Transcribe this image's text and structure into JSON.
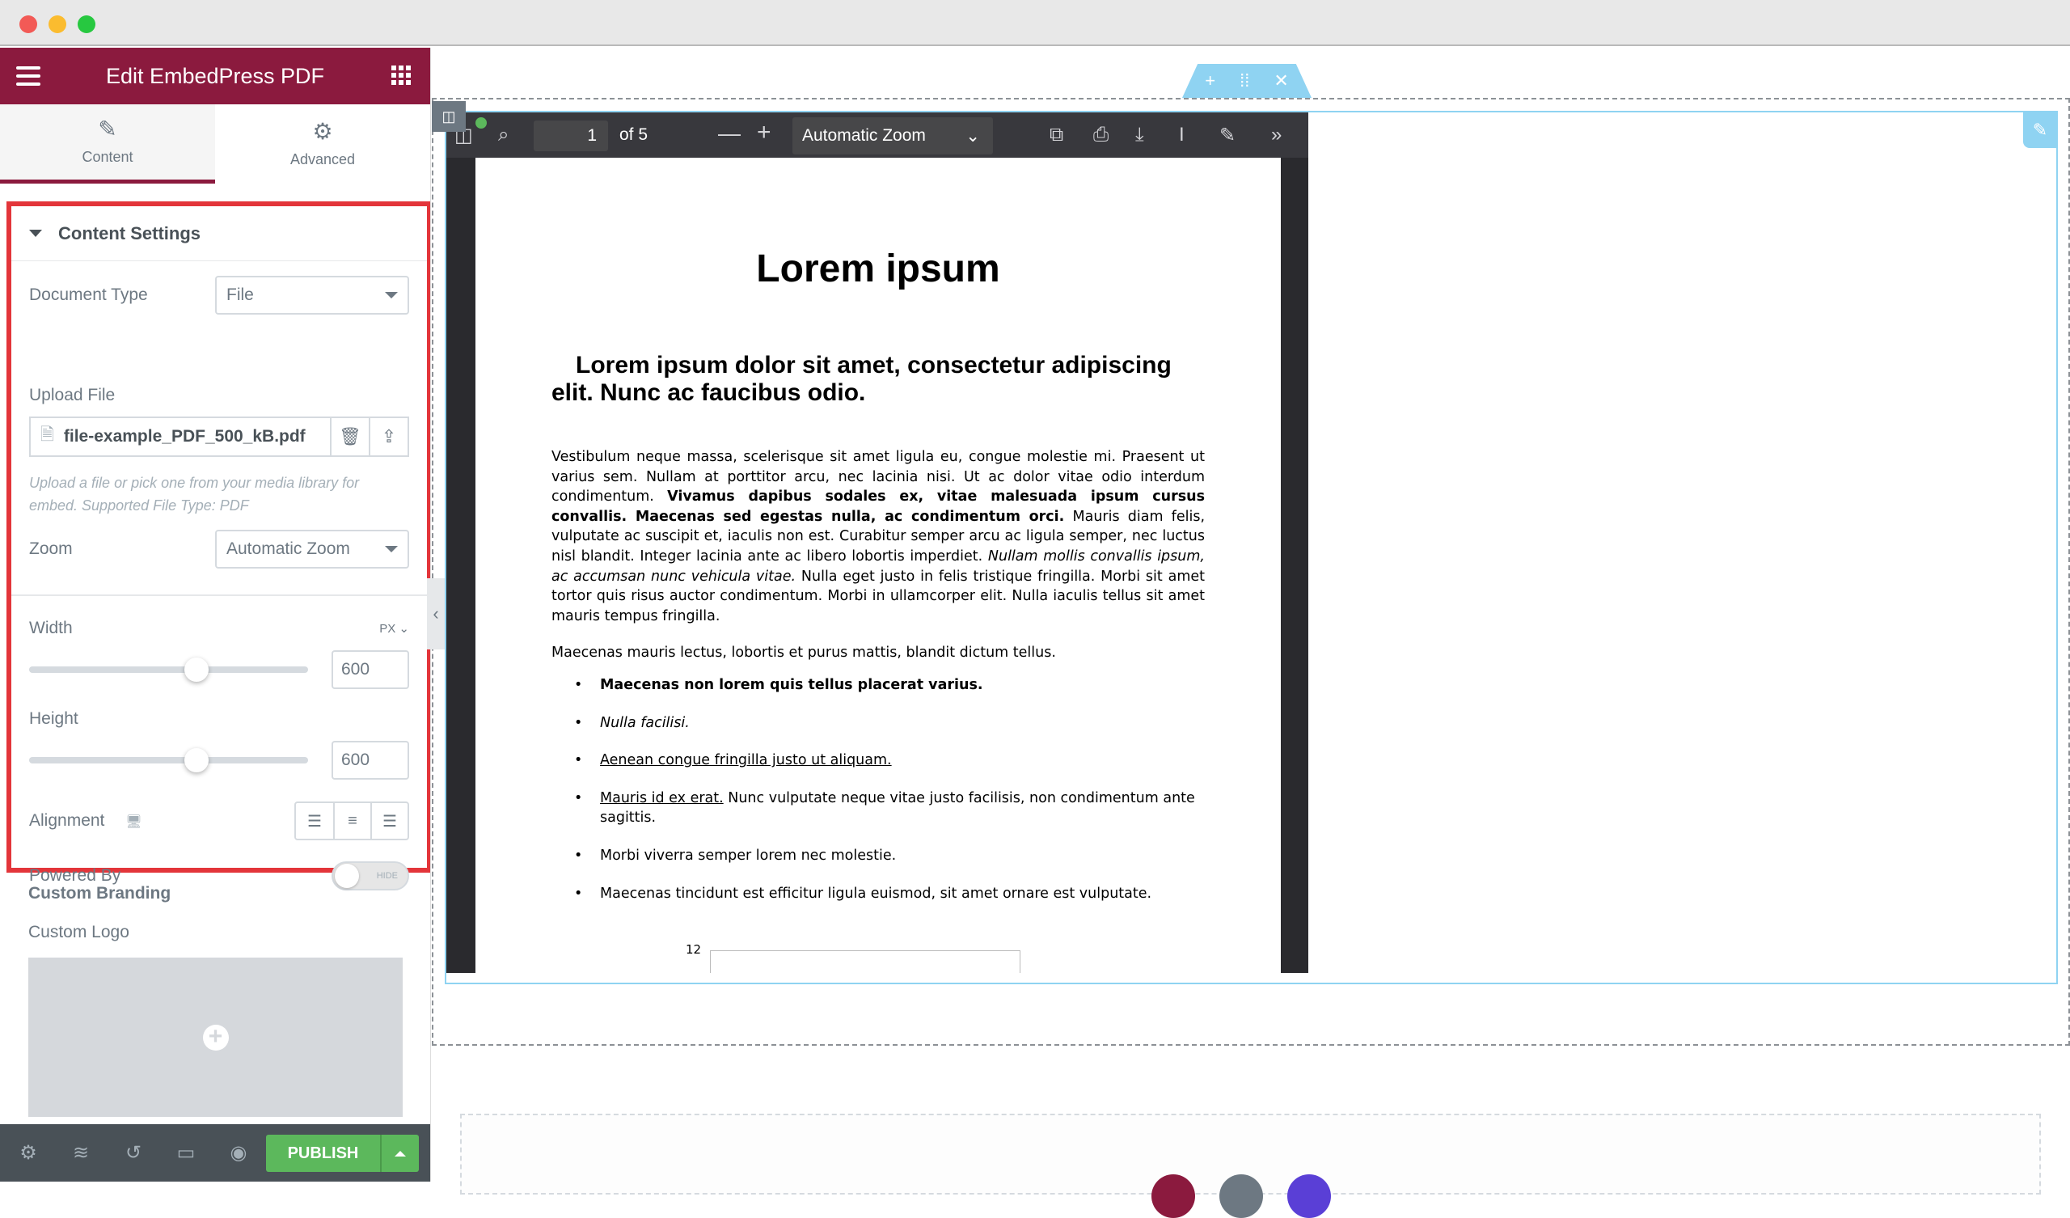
{
  "window": {
    "controls": [
      "close",
      "minimize",
      "maximize"
    ]
  },
  "sidebar": {
    "title": "Edit EmbedPress PDF",
    "tabs": [
      {
        "label": "Content",
        "icon": "pencil-icon",
        "active": true
      },
      {
        "label": "Advanced",
        "icon": "gear-icon",
        "active": false
      }
    ],
    "section_title": "Content Settings",
    "document_type": {
      "label": "Document Type",
      "value": "File"
    },
    "upload_file": {
      "label": "Upload File",
      "filename": "file-example_PDF_500_kB.pdf",
      "hint": "Upload a file or pick one from your media library for embed. Supported File Type: PDF"
    },
    "zoom": {
      "label": "Zoom",
      "value": "Automatic Zoom"
    },
    "width": {
      "label": "Width",
      "unit": "PX",
      "value": "600",
      "slider_fraction": 0.6
    },
    "height": {
      "label": "Height",
      "value": "600",
      "slider_fraction": 0.6
    },
    "alignment": {
      "label": "Alignment",
      "options": [
        "left",
        "center",
        "right"
      ]
    },
    "powered_by": {
      "label": "Powered By",
      "toggle_text": "HIDE",
      "on": false
    },
    "custom_branding": "Custom Branding",
    "custom_logo": "Custom Logo",
    "footer": {
      "publish_label": "PUBLISH"
    }
  },
  "canvas": {
    "handle_icons": [
      "plus-icon",
      "drag-icon",
      "close-icon"
    ],
    "pdf_viewer": {
      "page_current": "1",
      "page_total_text": "of 5",
      "zoom_value": "Automatic Zoom",
      "page": {
        "title": "Lorem ipsum",
        "subtitle": "Lorem ipsum dolor sit amet, consectetur adipiscing elit. Nunc ac faucibus odio.",
        "para1_a": "Vestibulum neque massa, scelerisque sit amet ligula eu, congue molestie mi. Praesent ut varius sem. Nullam at porttitor arcu, nec lacinia nisi. Ut ac dolor vitae odio interdum condimentum. ",
        "para1_b": "Vivamus dapibus sodales ex, vitae malesuada ipsum cursus convallis. Maecenas sed egestas nulla, ac condimentum orci.",
        "para1_c": " Mauris diam felis, vulputate ac suscipit et, iaculis non est. Curabitur semper arcu ac ligula semper, nec luctus nisl blandit. Integer lacinia ante ac libero lobortis imperdiet. ",
        "para1_d": "Nullam mollis convallis ipsum, ac accumsan nunc vehicula vitae.",
        "para1_e": " Nulla eget justo in felis tristique fringilla. Morbi sit amet tortor quis risus auctor condimentum. Morbi in ullamcorper elit. Nulla iaculis tellus sit amet mauris tempus fringilla.",
        "para2": "Maecenas mauris lectus, lobortis et purus mattis, blandit dictum tellus.",
        "list": {
          "item1": "Maecenas non lorem quis tellus placerat varius.",
          "item2": "Nulla facilisi.",
          "item3": "Aenean congue fringilla justo ut aliquam.",
          "item4_u": "Mauris id ex erat.",
          "item4_rest": " Nunc vulputate neque vitae justo facilisis, non condimentum ante sagittis.",
          "item5": "Morbi viverra semper lorem nec molestie.",
          "item6": "Maecenas tincidunt est efficitur ligula euismod, sit amet ornare est vulputate."
        },
        "chart_tick": "12"
      }
    }
  },
  "colors": {
    "brand": "#8b1a3e",
    "highlight": "#e3353a",
    "publish": "#5cb85c",
    "handle": "#8fd3f2"
  }
}
